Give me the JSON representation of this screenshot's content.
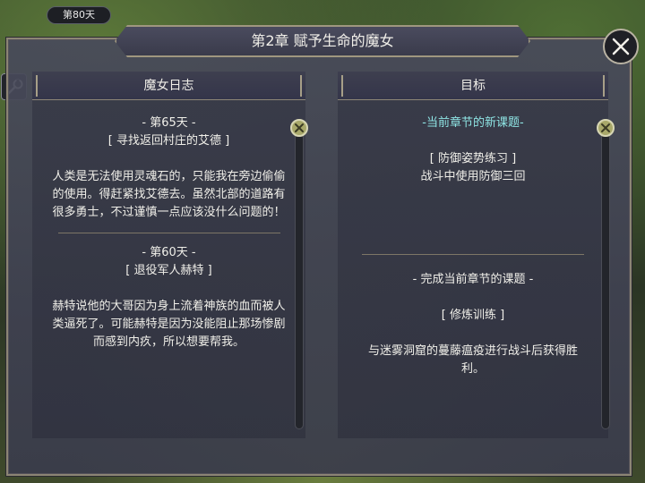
{
  "hud": {
    "day_label": "第80天"
  },
  "window": {
    "title": "第2章  赋予生命的魔女"
  },
  "journal": {
    "header": "魔女日志",
    "entries": [
      {
        "day": "- 第65天 -",
        "title": "[ 寻找返回村庄的艾德 ]",
        "body": "人类是无法使用灵魂石的，只能我在旁边偷偷的使用。得赶紧找艾德去。虽然北部的道路有很多勇士，不过谨慎一点应该没什么问题的！"
      },
      {
        "day": "- 第60天 -",
        "title": "[ 退役军人赫特 ]",
        "body": "赫特说他的大哥因为身上流着神族的血而被人类逼死了。可能赫特是因为没能阻止那场惨剧而感到内疚，所以想要帮我。"
      }
    ]
  },
  "goals": {
    "header": "目标",
    "current_label": "-当前章节的新课题-",
    "current_task_title": "[ 防御姿势练习 ]",
    "current_task_desc": "战斗中使用防御三回",
    "complete_label": "- 完成当前章节的课题 -",
    "complete_task_title": "[ 修炼训练 ]",
    "complete_task_desc": "与迷雾洞窟的蔓藤瘟疫进行战斗后获得胜利。"
  },
  "icons": {
    "settings": "wrench-icon",
    "close": "close-icon",
    "scroll_knob": "x-circle-icon"
  },
  "colors": {
    "accent_goal": "#8ee4e4",
    "panel_border": "#8c8575",
    "text": "#f0efe9"
  }
}
